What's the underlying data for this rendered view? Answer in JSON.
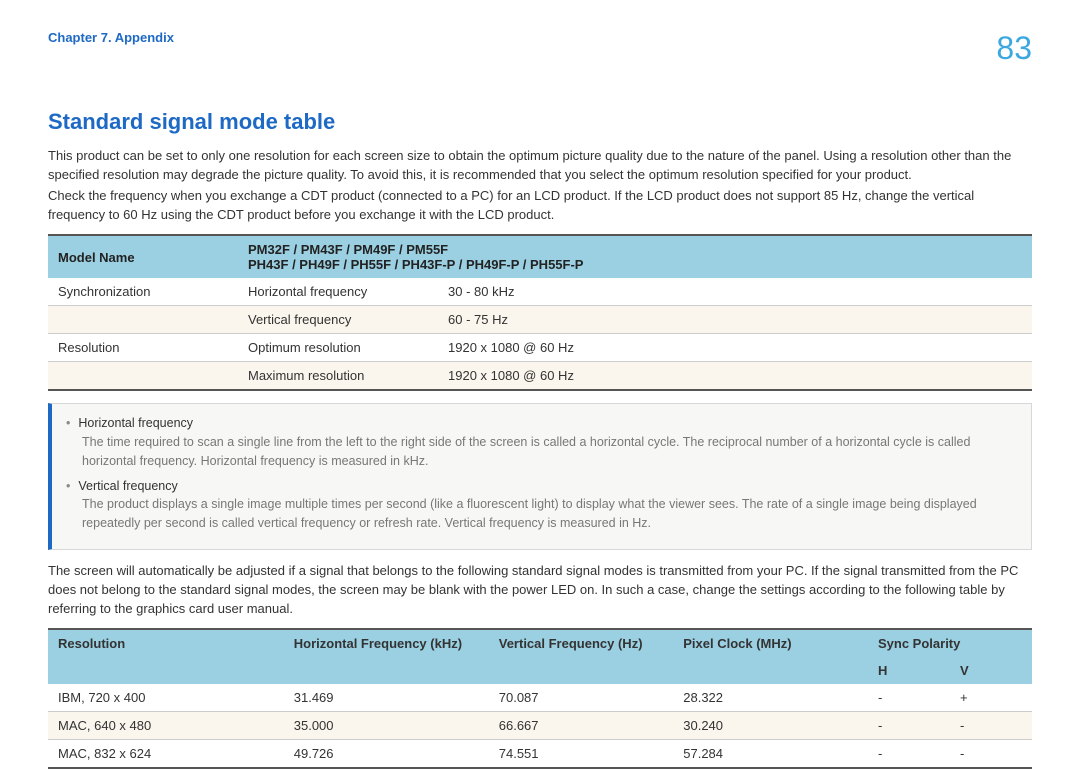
{
  "header": {
    "chapter": "Chapter 7. Appendix",
    "page_number": "83"
  },
  "section_title": "Standard signal mode table",
  "intro": {
    "p1": "This product can be set to only one resolution for each screen size to obtain the optimum picture quality due to the nature of the panel. Using a resolution other than the specified resolution may degrade the picture quality. To avoid this, it is recommended that you select the optimum resolution specified for your product.",
    "p2": "Check the frequency when you exchange a CDT product (connected to a PC) for an LCD product. If the LCD product does not support 85 Hz, change the vertical frequency to 60 Hz using the CDT product before you exchange it with the LCD product."
  },
  "table1": {
    "header_left": "Model Name",
    "header_right_line1": "PM32F / PM43F / PM49F / PM55F",
    "header_right_line2": "PH43F / PH49F / PH55F / PH43F-P / PH49F-P / PH55F-P",
    "rows": [
      {
        "label": "Synchronization",
        "sub": "Horizontal frequency",
        "val": "30 - 80 kHz"
      },
      {
        "label": "",
        "sub": "Vertical frequency",
        "val": "60 - 75 Hz"
      },
      {
        "label": "Resolution",
        "sub": "Optimum resolution",
        "val": "1920 x 1080 @ 60 Hz"
      },
      {
        "label": "",
        "sub": "Maximum resolution",
        "val": "1920 x 1080 @ 60 Hz"
      }
    ]
  },
  "note": {
    "items": [
      {
        "term": "Horizontal frequency",
        "def": "The time required to scan a single line from the left to the right side of the screen is called a horizontal cycle. The reciprocal number of a horizontal cycle is called horizontal frequency. Horizontal frequency is measured in kHz."
      },
      {
        "term": "Vertical frequency",
        "def": "The product displays a single image multiple times per second (like a fluorescent light) to display what the viewer sees. The rate of a single image being displayed repeatedly per second is called vertical frequency or refresh rate. Vertical frequency is measured in Hz."
      }
    ]
  },
  "mid_paragraph": "The screen will automatically be adjusted if a signal that belongs to the following standard signal modes is transmitted from your PC. If the signal transmitted from the PC does not belong to the standard signal modes, the screen may be blank with the power LED on. In such a case, change the settings according to the following table by referring to the graphics card user manual.",
  "table2": {
    "headers": {
      "resolution": "Resolution",
      "hfreq": "Horizontal Frequency (kHz)",
      "vfreq": "Vertical Frequency (Hz)",
      "pclock": "Pixel Clock (MHz)",
      "sync": "Sync Polarity",
      "sh": "H",
      "sv": "V"
    },
    "rows": [
      {
        "res": "IBM, 720 x 400",
        "hf": "31.469",
        "vf": "70.087",
        "pc": "28.322",
        "sh": "-",
        "sv": "+"
      },
      {
        "res": "MAC, 640 x 480",
        "hf": "35.000",
        "vf": "66.667",
        "pc": "30.240",
        "sh": "-",
        "sv": "-"
      },
      {
        "res": "MAC, 832 x 624",
        "hf": "49.726",
        "vf": "74.551",
        "pc": "57.284",
        "sh": "-",
        "sv": "-"
      }
    ]
  }
}
